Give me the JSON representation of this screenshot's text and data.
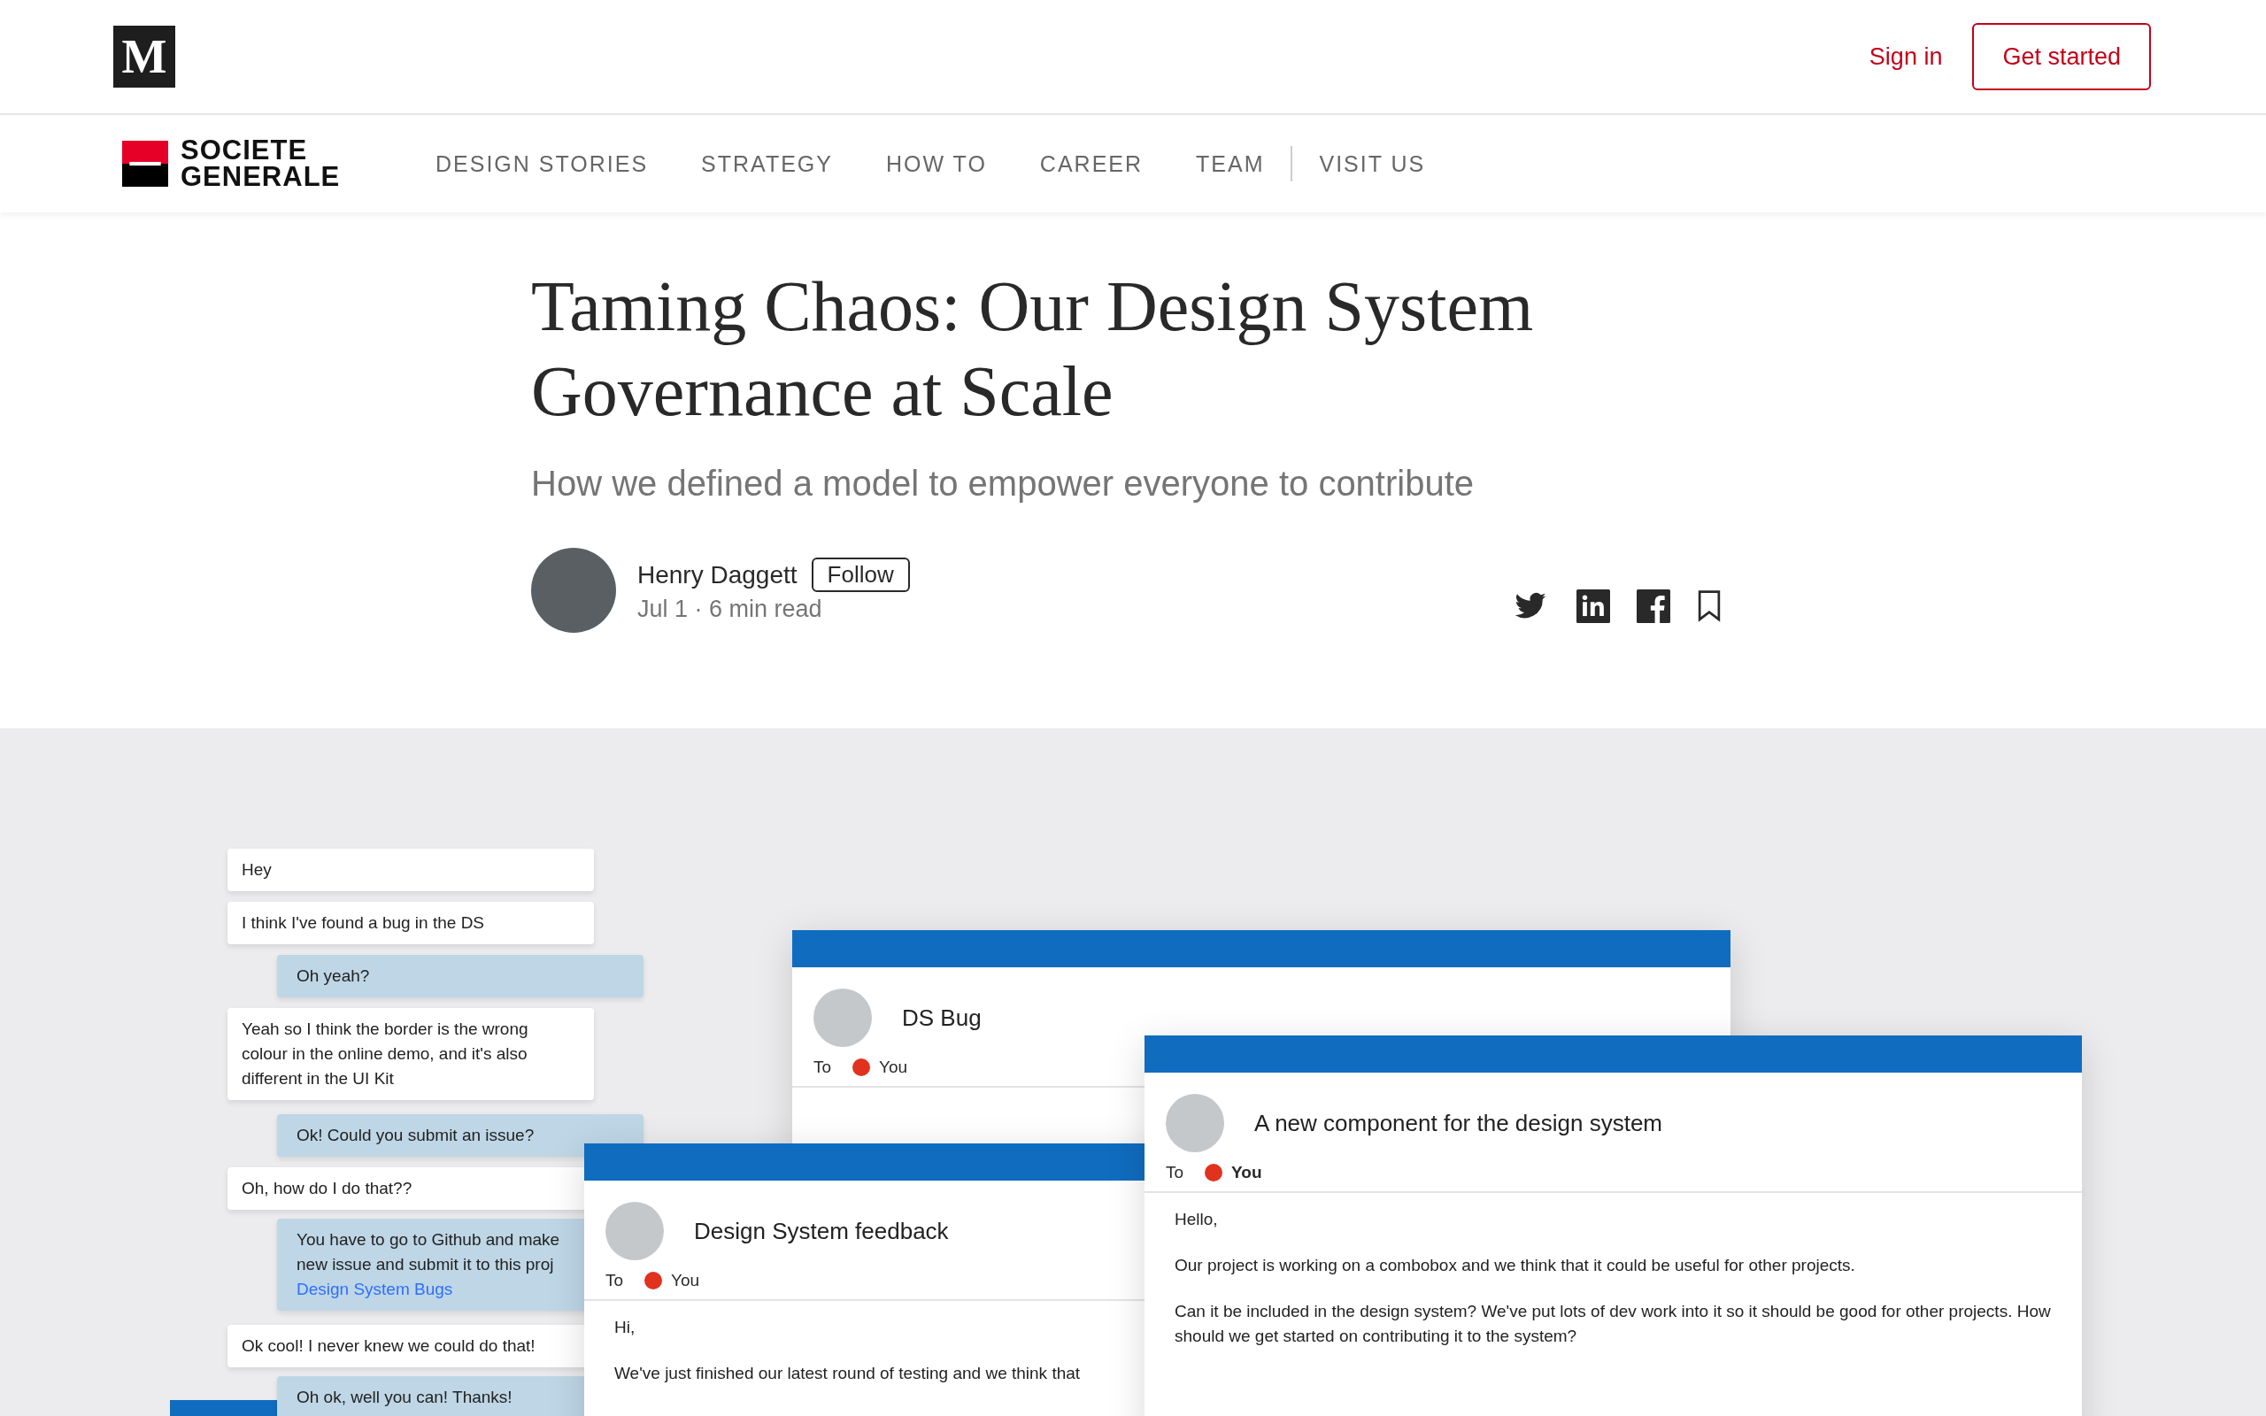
{
  "top_bar": {
    "logo": "M",
    "sign_in": "Sign in",
    "get_started": "Get started"
  },
  "publication": {
    "logo_lines": [
      "SOCIETE",
      "GENERALE"
    ],
    "nav": [
      {
        "label": "DESIGN STORIES"
      },
      {
        "label": "STRATEGY"
      },
      {
        "label": "HOW TO"
      },
      {
        "label": "CAREER"
      },
      {
        "label": "TEAM"
      }
    ],
    "secondary_nav": [
      {
        "label": "VISIT US"
      }
    ]
  },
  "article": {
    "title": "Taming Chaos: Our Design System Governance at Scale",
    "subtitle": "How we defined a model to empower everyone to contribute",
    "author": {
      "name": "Henry Daggett",
      "follow": "Follow",
      "meta": "Jul 1 · 6 min read"
    }
  },
  "hero": {
    "chat": [
      {
        "kind": "received",
        "lines": [
          "Hey"
        ]
      },
      {
        "kind": "received",
        "lines": [
          "I think I've found a bug in the DS"
        ]
      },
      {
        "kind": "sent",
        "lines": [
          "Oh yeah?"
        ]
      },
      {
        "kind": "received",
        "lines": [
          "Yeah so I think the border is the wrong",
          "colour in the online demo, and it's also",
          "different in the UI Kit"
        ]
      },
      {
        "kind": "sent",
        "lines": [
          "Ok! Could you submit an issue?"
        ]
      },
      {
        "kind": "received",
        "lines": [
          "Oh, how do I do that??"
        ]
      },
      {
        "kind": "sent",
        "lines": [
          "You have to go to Github and make",
          "new issue and submit it to this proj"
        ],
        "link": "Design System Bugs"
      },
      {
        "kind": "received",
        "lines": [
          "Ok cool! I never knew we could do that!"
        ]
      },
      {
        "kind": "sent",
        "lines": [
          "Oh ok, well you can! Thanks!"
        ]
      }
    ],
    "emails": [
      {
        "subject": "DS Bug",
        "to_label": "To",
        "recipient": "You"
      },
      {
        "subject": "Design System feedback",
        "to_label": "To",
        "recipient": "You",
        "body": [
          "Hi,",
          "We've just finished our latest round of testing and we think that"
        ]
      },
      {
        "subject": "A new component for the design system",
        "to_label": "To",
        "recipient": "You",
        "body": [
          "Hello,",
          "Our project is working on a combobox and we think that it could be useful for other projects.",
          "Can it be included in the design system? We've put lots of dev work into it so it should be good for other projects. How should we get started on contributing it to the system?"
        ]
      }
    ]
  }
}
